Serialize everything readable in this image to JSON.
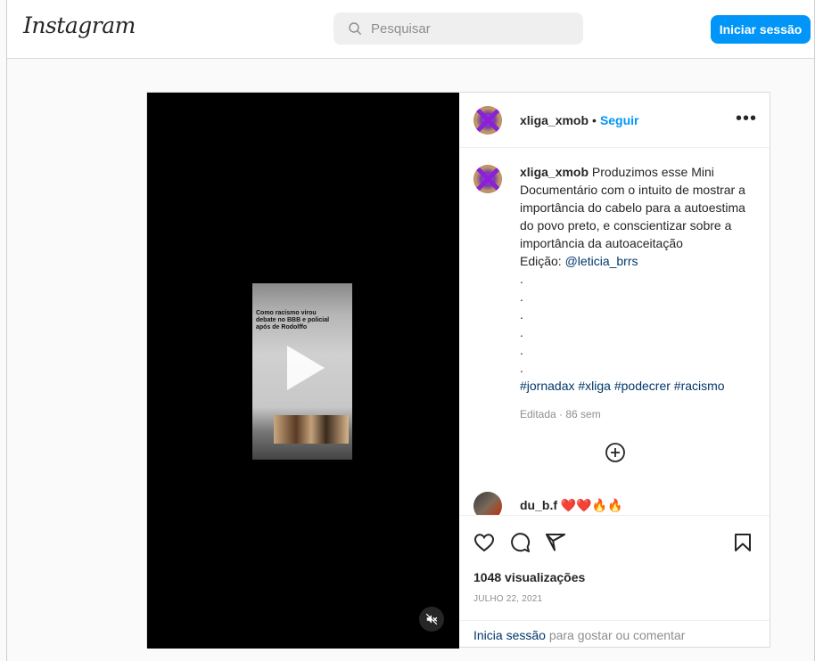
{
  "nav": {
    "logo": "Instagram",
    "search_placeholder": "Pesquisar",
    "login_button": "Iniciar sessão"
  },
  "post": {
    "username": "xliga_xmob",
    "separator": "•",
    "follow": "Seguir",
    "more": "•••",
    "caption": {
      "username": "xliga_xmob",
      "text": "Produzimos esse Mini Documentário com o intuito de mostrar a importância do cabelo para a autoestima do povo preto, e conscientizar sobre a importância da autoaceitação",
      "edition_label": "Edição: ",
      "edition_mention": "@leticia_brrs",
      "dots": [
        ".",
        ".",
        ".",
        ".",
        ".",
        "."
      ],
      "hashtags": "#jornadax #xliga #podecrer #racismo",
      "edited": "Editada · 86 sem"
    },
    "thumbnail_text": "Como racismo virou debate no BBB e policial após de Rodolffo",
    "comment": {
      "username": "du_b.f",
      "text": "❤️❤️🔥🔥"
    },
    "views": "1048 visualizações",
    "date": "JULHO 22, 2021",
    "login_prompt": {
      "link": "Inicia sessão",
      "rest": " para gostar ou comentar"
    }
  },
  "icons": {
    "search": "search-icon",
    "play": "play-icon",
    "mute": "mute-icon",
    "add": "add-circle-icon",
    "like": "heart-icon",
    "comment": "comment-icon",
    "share": "share-icon",
    "save": "bookmark-icon"
  }
}
